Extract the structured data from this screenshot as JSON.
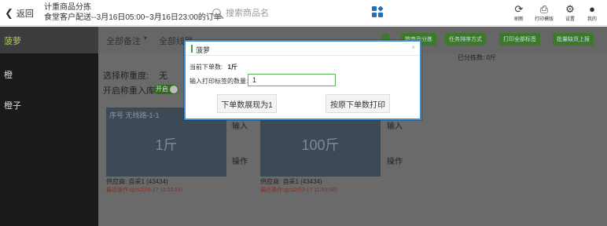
{
  "header": {
    "back_label": "返回",
    "title_line1": "计重商品分拣",
    "title_line2": "食堂客户配送--3月16日05:00~3月16日23:00的订单",
    "search_placeholder": "搜索商品名",
    "buttons": [
      {
        "icon": "refresh-icon",
        "label": "刷新"
      },
      {
        "icon": "printer-settings-icon",
        "label": "打印模版"
      },
      {
        "icon": "gear-icon",
        "label": "设置"
      },
      {
        "icon": "user-icon",
        "label": "我的"
      }
    ]
  },
  "sidebar": {
    "selected": "菠萝",
    "items": [
      "橙",
      "橙子"
    ]
  },
  "filter": {
    "remark": "全部备注",
    "route": "全部线路",
    "buttons": [
      "按商品分拣",
      "任务排序方式",
      "打印全部标签",
      "批量缺货上报"
    ]
  },
  "main": {
    "weight_label": "选择称重度:",
    "weight_value": "无",
    "enter_storage_label": "开启称重入库:",
    "toggle_label": "开启",
    "done_label": "已分拣数: 0斤",
    "cards": [
      {
        "hint": "序号 无线路-1-1",
        "value": "1斤",
        "supplier": "供应商: 自采1 (43434)",
        "recent": "最近操作:qjcs2(03-17 11:53:54)"
      },
      {
        "hint": "",
        "value": "100斤",
        "supplier": "供应商: 自采1 (43434)",
        "recent": "最近操作:qjcs2(03-17 11:53:58)"
      }
    ],
    "input_label": "输入",
    "op_label": "操作"
  },
  "modal": {
    "title": "菠萝",
    "close": "×",
    "order_qty_label": "当前下单数:",
    "order_qty_value": "1斤",
    "input_label": "输入打印标签的数量:",
    "input_value": "1",
    "btn_left": "下单数展现为1",
    "btn_right": "按原下单数打印"
  }
}
